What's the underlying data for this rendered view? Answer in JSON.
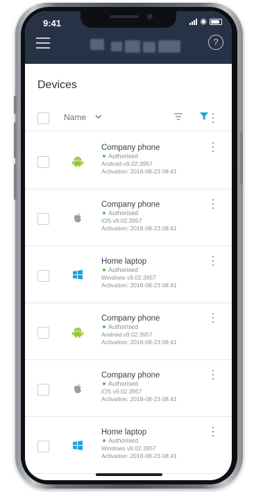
{
  "status_bar": {
    "time": "9:41"
  },
  "header": {
    "help_glyph": "?"
  },
  "page": {
    "title": "Devices"
  },
  "list_header": {
    "sort_label": "Name"
  },
  "colors": {
    "header_bg": "#283246",
    "accent": "#1aa3d9",
    "status_ok": "#4fbf4f",
    "android": "#9bc43a",
    "windows": "#1ba1e2",
    "apple": "#9a9da2"
  },
  "devices": [
    {
      "name": "Company phone",
      "status": "Authorised",
      "version": "Android v9.02.3957",
      "activation": "Activation: 2018-08-23  08:41",
      "os_icon": "android-icon"
    },
    {
      "name": "Company phone",
      "status": "Authorised",
      "version": "iOS v9.02.3957",
      "activation": "Activation: 2018-08-23  08:41",
      "os_icon": "apple-icon"
    },
    {
      "name": "Home laptop",
      "status": "Authorised",
      "version": "Windows v9.02.3957",
      "activation": "Activation: 2018-08-23  08:41",
      "os_icon": "windows-icon"
    },
    {
      "name": "Company phone",
      "status": "Authorised",
      "version": "Android v9.02.3957",
      "activation": "Activation: 2018-08-23  08:41",
      "os_icon": "android-icon"
    },
    {
      "name": "Company phone",
      "status": "Authorised",
      "version": "iOS v9.02.3957",
      "activation": "Activation: 2018-08-23  08:41",
      "os_icon": "apple-icon"
    },
    {
      "name": "Home laptop",
      "status": "Authorised",
      "version": "Windows v9.02.3957",
      "activation": "Activation: 2018-08-23  08:41",
      "os_icon": "windows-icon"
    }
  ]
}
